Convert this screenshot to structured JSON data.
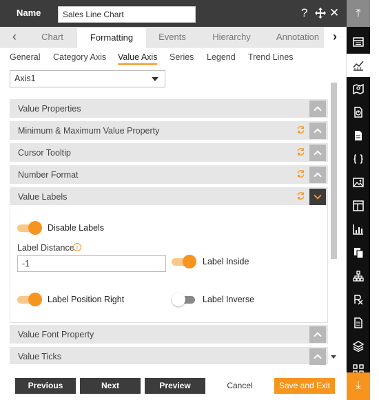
{
  "header": {
    "name_label": "Name",
    "name_value": "Sales Line Chart",
    "help_icon": "question-icon",
    "move_icon": "move-icon",
    "close_icon": "close-icon"
  },
  "tabs": [
    "Chart",
    "Formatting",
    "Events",
    "Hierarchy",
    "Annotation"
  ],
  "active_tab": "Formatting",
  "subtabs": [
    "General",
    "Category Axis",
    "Value Axis",
    "Series",
    "Legend",
    "Trend Lines"
  ],
  "active_subtab": "Value Axis",
  "axis_select": {
    "value": "Axis1"
  },
  "accordion": [
    {
      "title": "Value Properties",
      "refresh": false,
      "open": false
    },
    {
      "title": "Minimum & Maximum Value Property",
      "refresh": true,
      "open": false
    },
    {
      "title": "Cursor Tooltip",
      "refresh": true,
      "open": false
    },
    {
      "title": "Number Format",
      "refresh": true,
      "open": false
    },
    {
      "title": "Value Labels",
      "refresh": true,
      "open": true
    },
    {
      "title": "Value Font Property",
      "refresh": false,
      "open": false
    },
    {
      "title": "Value Ticks",
      "refresh": false,
      "open": false
    }
  ],
  "value_labels": {
    "disable_labels": {
      "label": "Disable Labels",
      "on": true
    },
    "label_distance": {
      "label": "Label Distance",
      "value": "-1",
      "info_icon": "info-icon"
    },
    "label_inside": {
      "label": "Label Inside",
      "on": true
    },
    "label_position_right": {
      "label": "Label Position Right",
      "on": true
    },
    "label_inverse": {
      "label": "Label Inverse",
      "on": false
    }
  },
  "footer": {
    "previous": "Previous",
    "next": "Next",
    "preview": "Preview",
    "cancel": "Cancel",
    "save_exit": "Save and Exit"
  },
  "rail": {
    "top_icon": "collapse-up-icon",
    "items": [
      "table-icon",
      "line-chart-icon",
      "map-icon",
      "document-chart-icon",
      "file-icon",
      "braces-icon",
      "image-icon",
      "panel-icon",
      "bar-chart-icon",
      "copy-icon",
      "hierarchy-icon",
      "rx-icon",
      "report-icon",
      "layers-icon",
      "grid-icon"
    ],
    "active_index": 1,
    "bottom_icon": "download-icon"
  },
  "colors": {
    "accent": "#f7941d",
    "header": "#3c3c3c"
  }
}
